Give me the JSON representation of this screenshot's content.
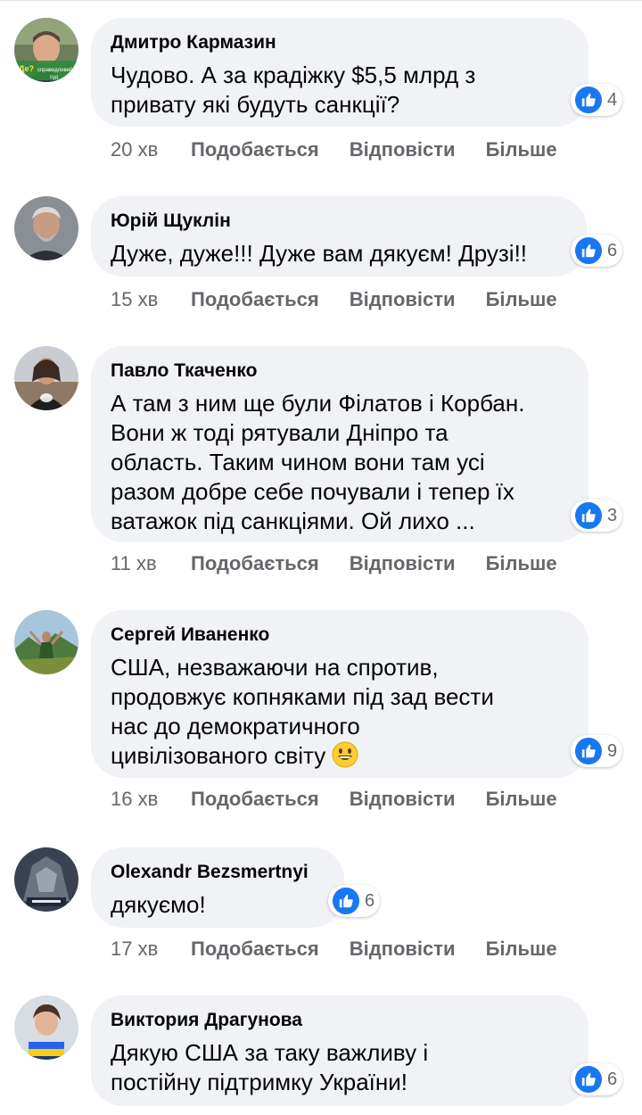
{
  "colors": {
    "bubble": "#f0f2f5",
    "like_blue": "#1877f2",
    "meta_gray": "#65676b"
  },
  "icons": {
    "reaction": "like-icon",
    "emoji": "grinning-face-emoji"
  },
  "comments": [
    {
      "author": "Дмитро Кармазин",
      "text": "Чудово. А за крадіжку $5,5 млрд з\nпривату які будуть санкції?",
      "reactions": "4",
      "time": "20 хв",
      "like": "Подобається",
      "reply": "Відповісти",
      "more": "Більше",
      "avatar_text": "Де? ... суд"
    },
    {
      "author": "Юрій Щуклін",
      "text": "Дуже, дуже!!! Дуже вам дякуєм! Друзі!!",
      "reactions": "6",
      "time": "15 хв",
      "like": "Подобається",
      "reply": "Відповісти",
      "more": "Більше"
    },
    {
      "author": "Павло Ткаченко",
      "text": "А там з ним ще були Філатов і Корбан.\nВони ж тоді рятували Дніпро та\nобласть. Таким чином вони там усі\nразом добре себе почували і тепер їх\nватажок під санкціями. Ой лихо ...",
      "reactions": "3",
      "time": "11 хв",
      "like": "Подобається",
      "reply": "Відповісти",
      "more": "Більше"
    },
    {
      "author": "Сергей Иваненко",
      "text": "США, незважаючи на спротив,\nпродовжує копняками під зад вести\nнас до демократичного\nцивілізованого світу",
      "reactions": "9",
      "time": "16 хв",
      "like": "Подобається",
      "reply": "Відповісти",
      "more": "Більше"
    },
    {
      "author": "Olexandr Bezsmertnyi",
      "text": "дякуємо!",
      "reactions": "6",
      "time": "17 хв",
      "like": "Подобається",
      "reply": "Відповісти",
      "more": "Більше"
    },
    {
      "author": "Виктория Драгунова",
      "text": "Дякую США за таку важливу і\nпостійну підтримку України!",
      "reactions": "6"
    }
  ]
}
